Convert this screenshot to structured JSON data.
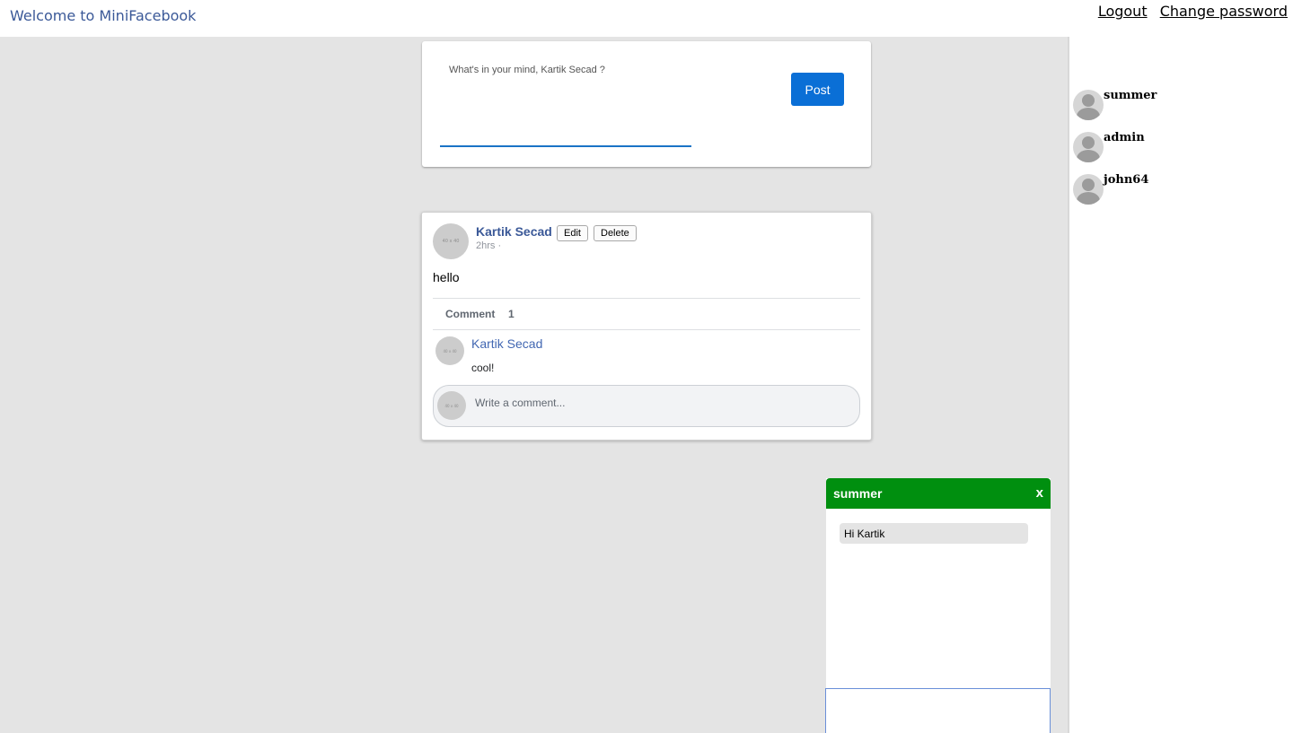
{
  "header": {
    "title": "Welcome to MiniFacebook",
    "logout_label": "Logout",
    "change_password_label": "Change password"
  },
  "composer": {
    "placeholder": "What's in your mind, Kartik Secad ?",
    "post_label": "Post"
  },
  "post": {
    "author": "Kartik Secad",
    "edit_label": "Edit",
    "delete_label": "Delete",
    "time": "2hrs ·",
    "body": "hello",
    "avatar_text": "40 x 40",
    "comment_label": "Comment",
    "comment_count": "1",
    "comments": [
      {
        "author": "Kartik Secad",
        "text": "cool!",
        "avatar_text": "40 x 40"
      }
    ],
    "comment_input_placeholder": "Write a comment...",
    "comment_input_avatar_text": "40 x 40"
  },
  "sidebar": {
    "friends": [
      {
        "name": "summer",
        "icon": "user-avatar-icon"
      },
      {
        "name": "admin",
        "icon": "user-avatar-icon"
      },
      {
        "name": "john64",
        "icon": "user-avatar-icon"
      }
    ]
  },
  "chat": {
    "title": "summer",
    "close_label": "x",
    "messages": [
      {
        "text": "Hi Kartik"
      }
    ],
    "header_color": "#008f0f"
  },
  "colors": {
    "brand": "#3b5998",
    "post_button": "#0a6fd6",
    "page_background": "#e4e4e4"
  }
}
